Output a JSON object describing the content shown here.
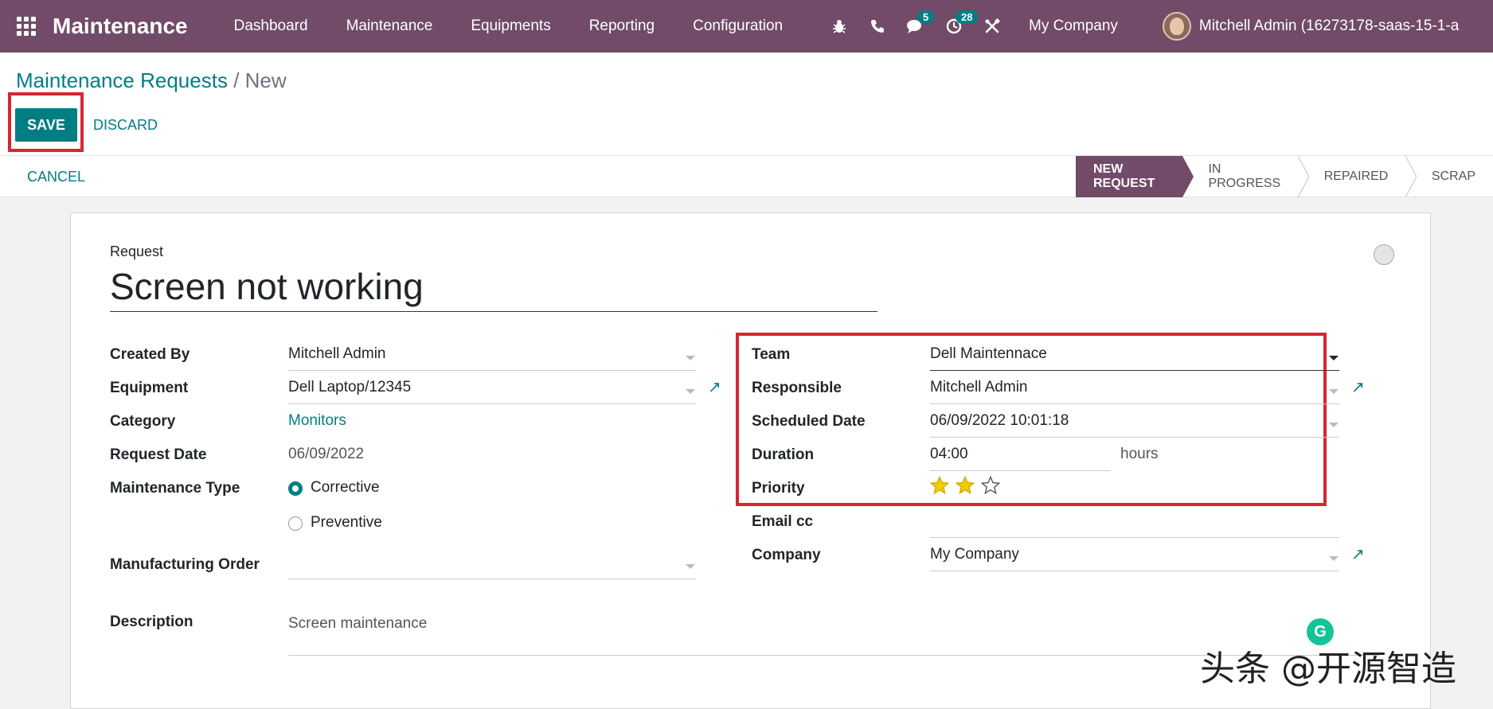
{
  "navbar": {
    "app_name": "Maintenance",
    "menu": [
      "Dashboard",
      "Maintenance",
      "Equipments",
      "Reporting",
      "Configuration"
    ],
    "systray": {
      "bug_icon": "bug-icon",
      "phone_icon": "phone-icon",
      "chat_badge": "5",
      "activity_badge": "28",
      "tools_icon": "tools-icon"
    },
    "company": "My Company",
    "user": "Mitchell Admin (16273178-saas-15-1-a"
  },
  "breadcrumb": {
    "parent": "Maintenance Requests",
    "separator": "/",
    "current": "New"
  },
  "buttons": {
    "save": "SAVE",
    "discard": "DISCARD",
    "cancel": "CANCEL"
  },
  "stages": [
    "NEW REQUEST",
    "IN PROGRESS",
    "REPAIRED",
    "SCRAP"
  ],
  "form": {
    "request_label": "Request",
    "request_title": "Screen not working",
    "left": {
      "created_by_label": "Created By",
      "created_by": "Mitchell Admin",
      "equipment_label": "Equipment",
      "equipment": "Dell Laptop/12345",
      "category_label": "Category",
      "category": "Monitors",
      "request_date_label": "Request Date",
      "request_date": "06/09/2022",
      "maintenance_type_label": "Maintenance Type",
      "type_options": [
        "Corrective",
        "Preventive"
      ],
      "manufacturing_order_label": "Manufacturing Order",
      "description_label": "Description",
      "description": "Screen maintenance"
    },
    "right": {
      "team_label": "Team",
      "team": "Dell Maintennace",
      "responsible_label": "Responsible",
      "responsible": "Mitchell Admin",
      "scheduled_date_label": "Scheduled Date",
      "scheduled_date": "06/09/2022 10:01:18",
      "duration_label": "Duration",
      "duration": "04:00",
      "duration_unit": "hours",
      "priority_label": "Priority",
      "priority_value": 2,
      "priority_max": 3,
      "email_cc_label": "Email cc",
      "company_label": "Company",
      "company": "My Company"
    }
  },
  "watermark": "头条 @开源智造",
  "colors": {
    "brand": "#714b67",
    "accent": "#017e84",
    "highlight": "#d62631",
    "star": "#f3cc00"
  }
}
